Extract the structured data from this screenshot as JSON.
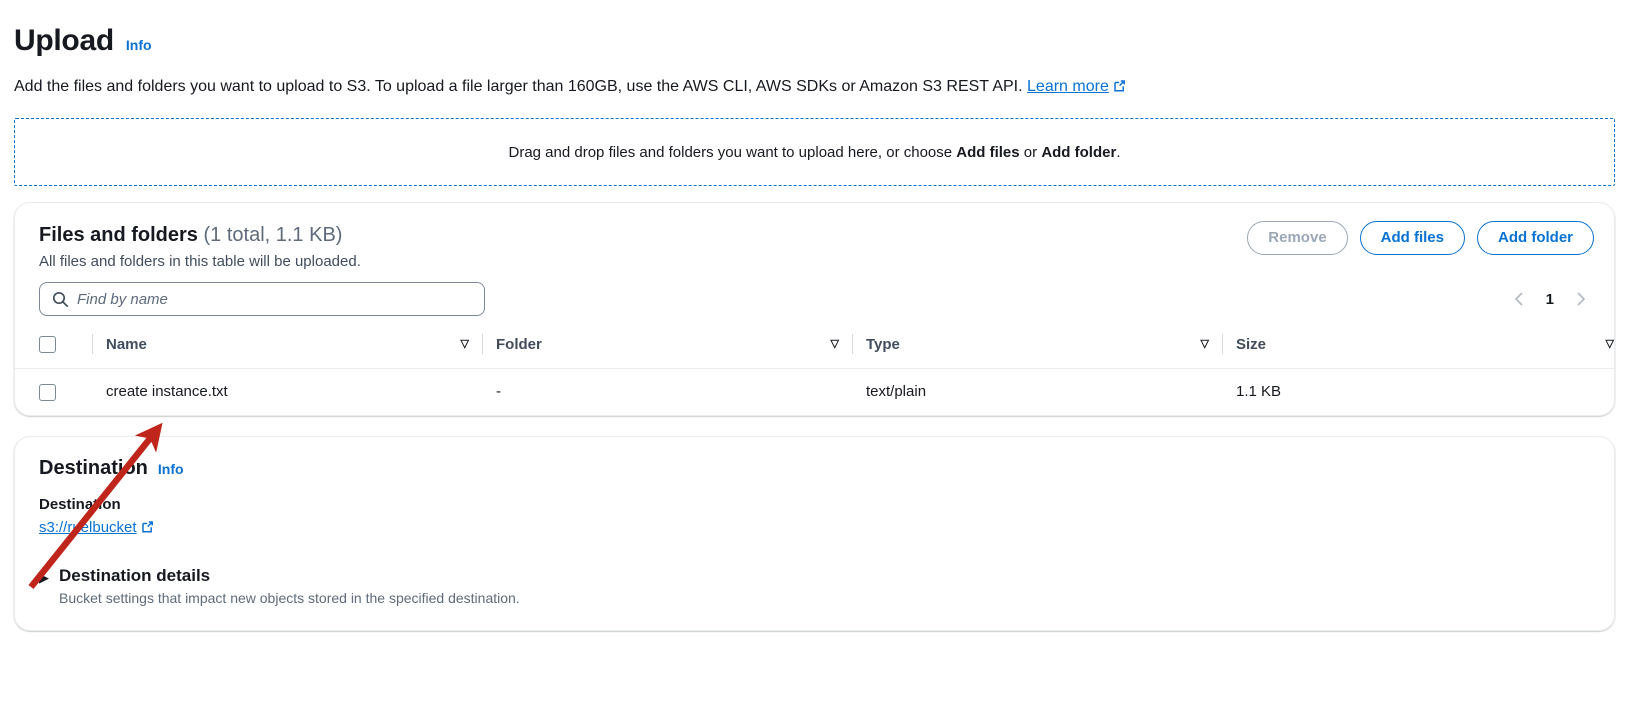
{
  "header": {
    "title": "Upload",
    "info_label": "Info",
    "description_before": "Add the files and folders you want to upload to S3. To upload a file larger than 160GB, use the AWS CLI, AWS SDKs or Amazon S3 REST API.",
    "learn_more_label": "Learn more"
  },
  "dropzone": {
    "text_start": "Drag and drop files and folders you want to upload here, or choose ",
    "bold_add_files": "Add files",
    "text_mid": " or ",
    "bold_add_folder": "Add folder",
    "text_end": "."
  },
  "files_panel": {
    "title": "Files and folders",
    "count": "(1 total, 1.1 KB)",
    "subtitle": "All files and folders in this table will be uploaded.",
    "remove_label": "Remove",
    "add_files_label": "Add files",
    "add_folder_label": "Add folder",
    "search_placeholder": "Find by name",
    "search_value": "",
    "pagination": {
      "prev_icon": "chevron-left-icon",
      "page": "1",
      "next_icon": "chevron-right-icon"
    },
    "columns": [
      "Name",
      "Folder",
      "Type",
      "Size"
    ],
    "rows": [
      {
        "name": "create instance.txt",
        "folder": "-",
        "type": "text/plain",
        "size": "1.1 KB",
        "selected": false
      }
    ]
  },
  "destination": {
    "title": "Destination",
    "info_label": "Info",
    "field_label": "Destination",
    "bucket_link": "s3://ruelbucket",
    "details_title": "Destination details",
    "details_subtitle": "Bucket settings that impact new objects stored in the specified destination."
  },
  "colors": {
    "link": "#0972d3",
    "annotation_arrow": "#c0251b",
    "text": "#16191f",
    "muted": "#5f6b7a",
    "border": "#e9ebed"
  }
}
